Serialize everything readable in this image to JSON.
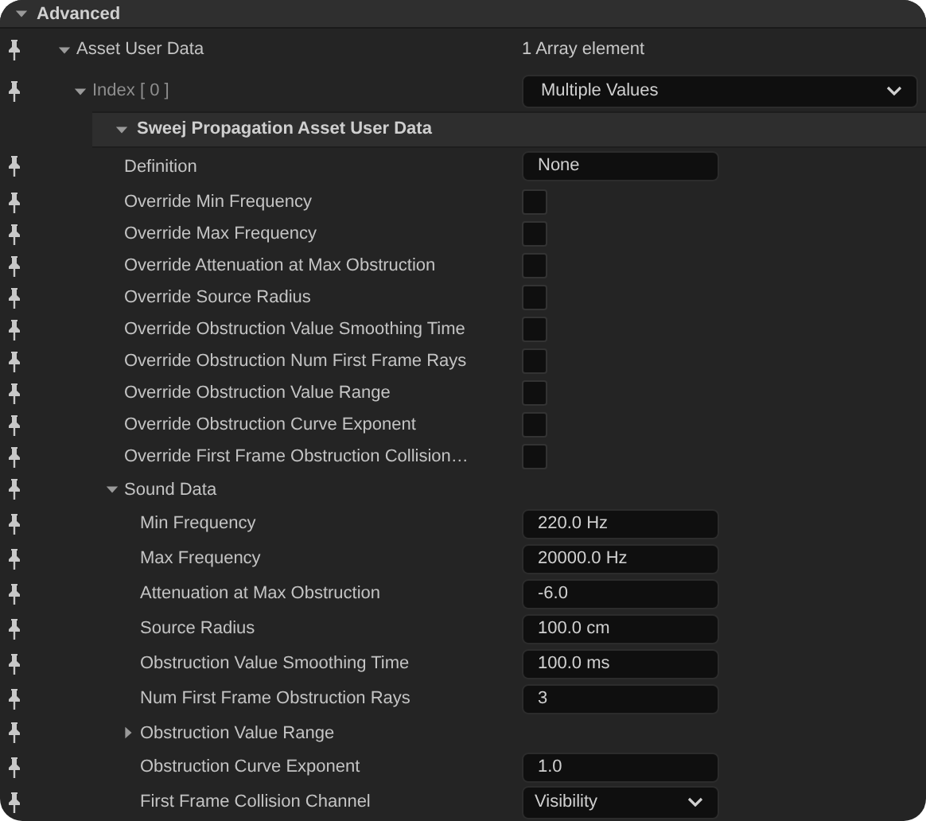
{
  "section": {
    "title": "Advanced",
    "expanded": true
  },
  "rows": [
    {
      "kind": "group",
      "label": "Asset User Data",
      "expanded": true,
      "value": "1 Array element",
      "children": [
        {
          "kind": "element",
          "label": "Index [ 0 ]",
          "expanded": true,
          "value": "Multiple Values",
          "children": [
            {
              "kind": "header",
              "label": "Sweej Propagation Asset User Data",
              "expanded": true,
              "children": [
                {
                  "kind": "field",
                  "label": "Definition",
                  "value": "None"
                },
                {
                  "kind": "checkbox",
                  "label": "Override Min Frequency",
                  "checked": false
                },
                {
                  "kind": "checkbox",
                  "label": "Override Max Frequency",
                  "checked": false
                },
                {
                  "kind": "checkbox",
                  "label": "Override Attenuation at Max Obstruction",
                  "checked": false
                },
                {
                  "kind": "checkbox",
                  "label": "Override Source Radius",
                  "checked": false
                },
                {
                  "kind": "checkbox",
                  "label": "Override Obstruction Value Smoothing Time",
                  "checked": false
                },
                {
                  "kind": "checkbox",
                  "label": "Override Obstruction Num First Frame Rays",
                  "checked": false
                },
                {
                  "kind": "checkbox",
                  "label": "Override Obstruction Value Range",
                  "checked": false
                },
                {
                  "kind": "checkbox",
                  "label": "Override Obstruction Curve Exponent",
                  "checked": false
                },
                {
                  "kind": "checkbox",
                  "label": "Override First Frame Obstruction Collision…",
                  "checked": false
                },
                {
                  "kind": "group",
                  "label": "Sound Data",
                  "expanded": true,
                  "children": [
                    {
                      "kind": "field",
                      "label": "Min Frequency",
                      "value": "220.0 Hz"
                    },
                    {
                      "kind": "field",
                      "label": "Max Frequency",
                      "value": "20000.0 Hz"
                    },
                    {
                      "kind": "field",
                      "label": "Attenuation at Max Obstruction",
                      "value": "-6.0"
                    },
                    {
                      "kind": "field",
                      "label": "Source Radius",
                      "value": "100.0 cm"
                    },
                    {
                      "kind": "field",
                      "label": "Obstruction Value Smoothing Time",
                      "value": "100.0 ms"
                    },
                    {
                      "kind": "field",
                      "label": "Num First Frame Obstruction Rays",
                      "value": "3"
                    },
                    {
                      "kind": "group",
                      "label": "Obstruction Value Range",
                      "expanded": false
                    },
                    {
                      "kind": "field",
                      "label": "Obstruction Curve Exponent",
                      "value": "1.0"
                    },
                    {
                      "kind": "combo",
                      "label": "First Frame Collision Channel",
                      "value": "Visibility"
                    }
                  ]
                }
              ]
            }
          ]
        }
      ]
    }
  ]
}
